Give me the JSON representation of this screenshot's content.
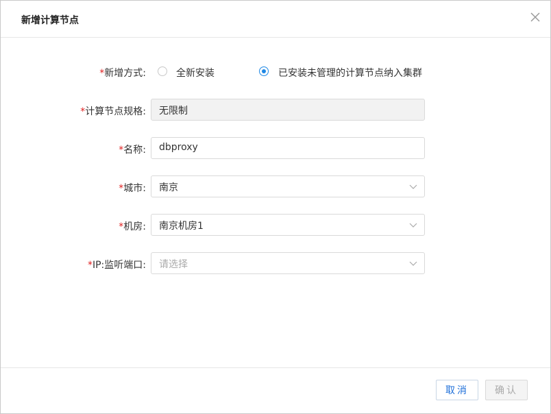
{
  "dialog": {
    "title": "新增计算节点"
  },
  "form": {
    "required_mark": "*",
    "add_mode": {
      "label": "新增方式:",
      "options": [
        {
          "label": "全新安装",
          "checked": false
        },
        {
          "label": "已安装未管理的计算节点纳入集群",
          "checked": true
        }
      ]
    },
    "spec": {
      "label": "计算节点规格:",
      "value": "无限制"
    },
    "name": {
      "label": "名称:",
      "value": "dbproxy"
    },
    "city": {
      "label": "城市:",
      "value": "南京"
    },
    "room": {
      "label": "机房:",
      "value": "南京机房1"
    },
    "ip_port": {
      "label": "IP:监听端口:",
      "placeholder": "请选择",
      "value": ""
    }
  },
  "footer": {
    "cancel_label": "取消",
    "confirm_label": "确认"
  },
  "colors": {
    "accent": "#1e88e5",
    "required": "#e02020"
  }
}
